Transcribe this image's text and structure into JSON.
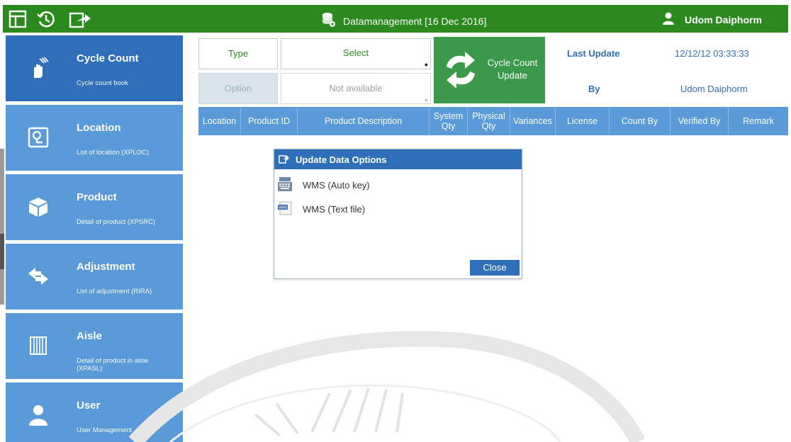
{
  "topbar": {
    "title": "Datamanagement [16 Dec 2016]",
    "user": "Udom Daiphorm"
  },
  "sidebar": {
    "items": [
      {
        "title": "Cycle Count",
        "subtitle": "Cycle count book",
        "icon": "hand-touch-icon",
        "active": true
      },
      {
        "title": "Location",
        "subtitle": "List of location (XPLOC)",
        "icon": "location-pin-icon"
      },
      {
        "title": "Product",
        "subtitle": "Detail of product (XPSRC)",
        "icon": "box-icon"
      },
      {
        "title": "Adjustment",
        "subtitle": "List of adjustment (RIRA)",
        "icon": "swap-arrows-icon"
      },
      {
        "title": "Aisle",
        "subtitle": "Detail of product in aisle (XPASL)",
        "icon": "aisle-icon"
      },
      {
        "title": "User",
        "subtitle": "User Management",
        "icon": "user-icon"
      }
    ]
  },
  "controls": {
    "type_label": "Type",
    "type_select_value": "Select",
    "option_label": "Option",
    "option_select_value": "Not available",
    "cycle_count_button": "Cycle Count Update",
    "last_update_label": "Last Update",
    "last_update_value": "12/12/12  03:33:33",
    "by_label": "By",
    "by_value": "Udom Daiphorm"
  },
  "table": {
    "columns": [
      "Location",
      "Product ID",
      "Product Description",
      "System Qty",
      "Physical Qty",
      "Variances",
      "License",
      "Count By",
      "Verified By",
      "Remark"
    ]
  },
  "dialog": {
    "title": "Update Data Options",
    "options": [
      {
        "label": "WMS (Auto key)",
        "icon": "keyboard-icon"
      },
      {
        "label": "WMS (Text file)",
        "icon": "text-file-icon"
      }
    ],
    "close_label": "Close"
  },
  "colors": {
    "topbar": "#2b8a1e",
    "sidebar": "#5a9ad8",
    "sidebar_active": "#2f6eb8",
    "accent_green": "#3a9a4a"
  }
}
